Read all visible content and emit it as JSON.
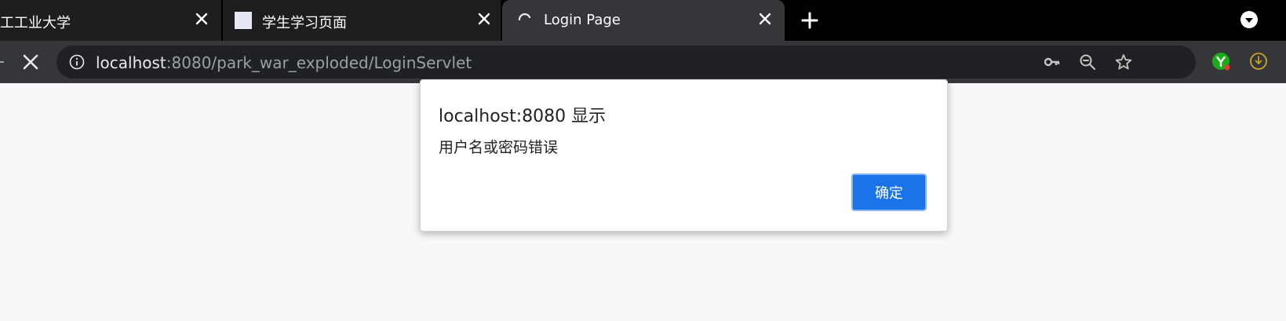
{
  "tabs": [
    {
      "title": "工工业大学"
    },
    {
      "title": "学生学习页面"
    },
    {
      "title": "Login Page"
    }
  ],
  "address_bar": {
    "host": "localhost",
    "path": ":8080/park_war_exploded/LoginServlet"
  },
  "dialog": {
    "title": "localhost:8080 显示",
    "message": "用户名或密码错误",
    "ok_label": "确定"
  },
  "colors": {
    "tabstrip_bg": "#000000",
    "active_tab_bg": "#35363a",
    "omnibox_bg": "#202124",
    "page_bg": "#f7f8fa",
    "primary_button": "#1a73e8"
  }
}
